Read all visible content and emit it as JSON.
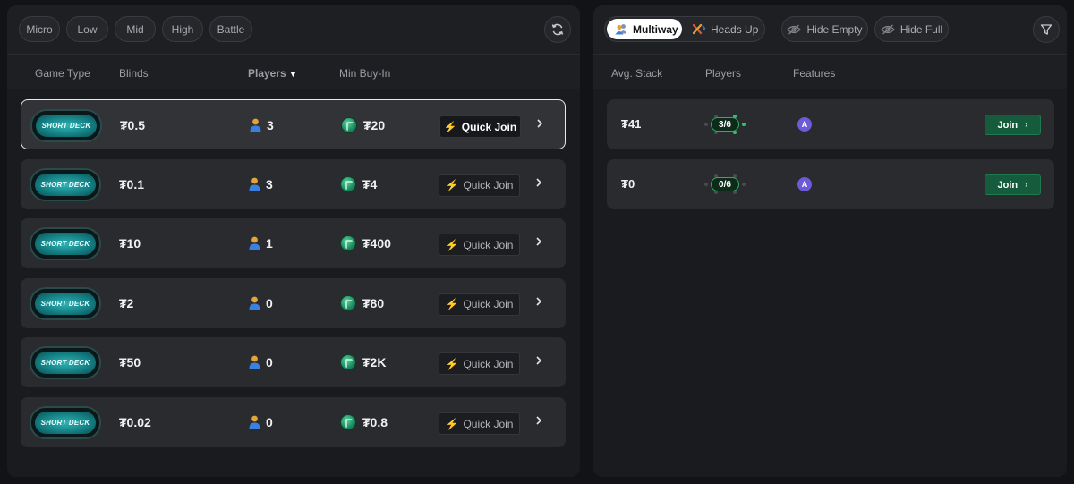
{
  "left": {
    "stakes": [
      "Micro",
      "Low",
      "Mid",
      "High",
      "Battle"
    ],
    "refresh_icon": "refresh-icon",
    "columns": {
      "game_type": "Game Type",
      "blinds": "Blinds",
      "players": "Players",
      "players_sort": "▼",
      "min_buyin": "Min Buy-In"
    },
    "rows": [
      {
        "deck": "SHORT DECK",
        "blinds": "₮0.5",
        "players": "3",
        "min_buyin": "₮20",
        "quick_join": "Quick Join",
        "selected": true
      },
      {
        "deck": "SHORT DECK",
        "blinds": "₮0.1",
        "players": "3",
        "min_buyin": "₮4",
        "quick_join": "Quick Join",
        "selected": false
      },
      {
        "deck": "SHORT DECK",
        "blinds": "₮10",
        "players": "1",
        "min_buyin": "₮400",
        "quick_join": "Quick Join",
        "selected": false
      },
      {
        "deck": "SHORT DECK",
        "blinds": "₮2",
        "players": "0",
        "min_buyin": "₮80",
        "quick_join": "Quick Join",
        "selected": false
      },
      {
        "deck": "SHORT DECK",
        "blinds": "₮50",
        "players": "0",
        "min_buyin": "₮2K",
        "quick_join": "Quick Join",
        "selected": false
      },
      {
        "deck": "SHORT DECK",
        "blinds": "₮0.02",
        "players": "0",
        "min_buyin": "₮0.8",
        "quick_join": "Quick Join",
        "selected": false
      }
    ]
  },
  "right": {
    "mode_tabs": [
      {
        "label": "Multiway",
        "active": true
      },
      {
        "label": "Heads Up",
        "active": false
      }
    ],
    "filters": [
      "Hide Empty",
      "Hide Full"
    ],
    "filter_icon": "filter-icon",
    "columns": {
      "avg_stack": "Avg. Stack",
      "players": "Players",
      "features": "Features"
    },
    "tables": [
      {
        "avg_stack": "₮41",
        "seats": "3/6",
        "occupied": 3,
        "capacity": 6,
        "feature": "A",
        "join": "Join"
      },
      {
        "avg_stack": "₮0",
        "seats": "0/6",
        "occupied": 0,
        "capacity": 6,
        "feature": "A",
        "join": "Join"
      }
    ]
  },
  "colors": {
    "background": "#121316",
    "panel": "#1e1f23",
    "row": "#2a2b2f",
    "join_green": "#145c3b",
    "deck_teal": "#1b9a9e",
    "bolt_gold": "#e5a92a",
    "feature_purple": "#6d5ad8"
  }
}
